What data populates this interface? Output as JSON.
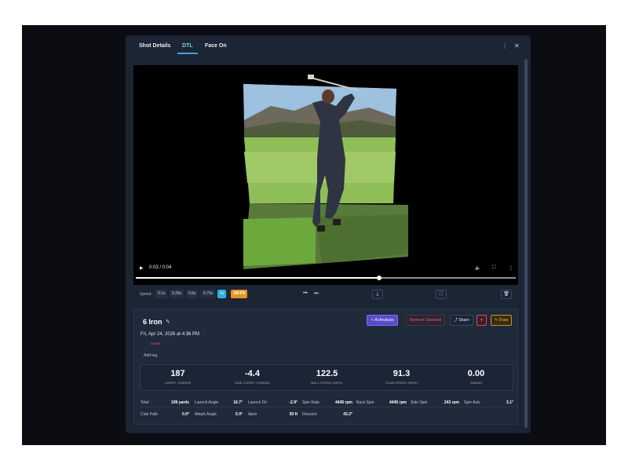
{
  "tabs": [
    "Shot Details",
    "DTL",
    "Face On"
  ],
  "icons": {
    "menu": "⋮",
    "close": "✕"
  },
  "video": {
    "time": "0:03 / 0:04",
    "progress": 0.64
  },
  "speed": {
    "label": "Speed:",
    "options": [
      "0.1x",
      "0.25x",
      "0.5x",
      "0.75x",
      "1x",
      "30FPS"
    ],
    "selected": "1x"
  },
  "shot": {
    "club": "6 Iron",
    "date": "Fri, Apr 24, 2026 at 4:36 PM",
    "id": "193484",
    "add_tag": "Add tag"
  },
  "actions": {
    "ai": "AI Analysis",
    "remove": "Remove Standard",
    "share": "Share",
    "draw": "Draw"
  },
  "metrics": [
    {
      "value": "187",
      "label": "CARRY (YARDS)"
    },
    {
      "value": "-4.4",
      "label": "SIDE CARRY (YARDS)"
    },
    {
      "value": "122.5",
      "label": "BALL SPEED (MPH)"
    },
    {
      "value": "91.3",
      "label": "CLUB SPEED (MPH)"
    },
    {
      "value": "0.00",
      "label": "SMASH"
    }
  ],
  "stats_row1": [
    {
      "k": "Total",
      "v": "199 yards"
    },
    {
      "k": "Launch Angle",
      "v": "16.7°"
    },
    {
      "k": "Launch Dir",
      "v": "-2.9°"
    },
    {
      "k": "Spin Rate",
      "v": "4445 rpm"
    },
    {
      "k": "Back Spin",
      "v": "4445 rpm"
    },
    {
      "k": "Side Spin",
      "v": "243 rpm"
    },
    {
      "k": "Spin Axis",
      "v": "3.1°"
    }
  ],
  "stats_row2": [
    {
      "k": "Club Path",
      "v": "0.0°"
    },
    {
      "k": "Attack Angle",
      "v": "0.0°"
    },
    {
      "k": "Apex",
      "v": "93 ft"
    },
    {
      "k": "Descent",
      "v": "43.2°"
    }
  ],
  "colors": {
    "accent": "#2eb1d8",
    "fps": "#e69320",
    "ai": "#6b5bd6",
    "danger": "#e0568a",
    "draw": "#e6a526"
  }
}
